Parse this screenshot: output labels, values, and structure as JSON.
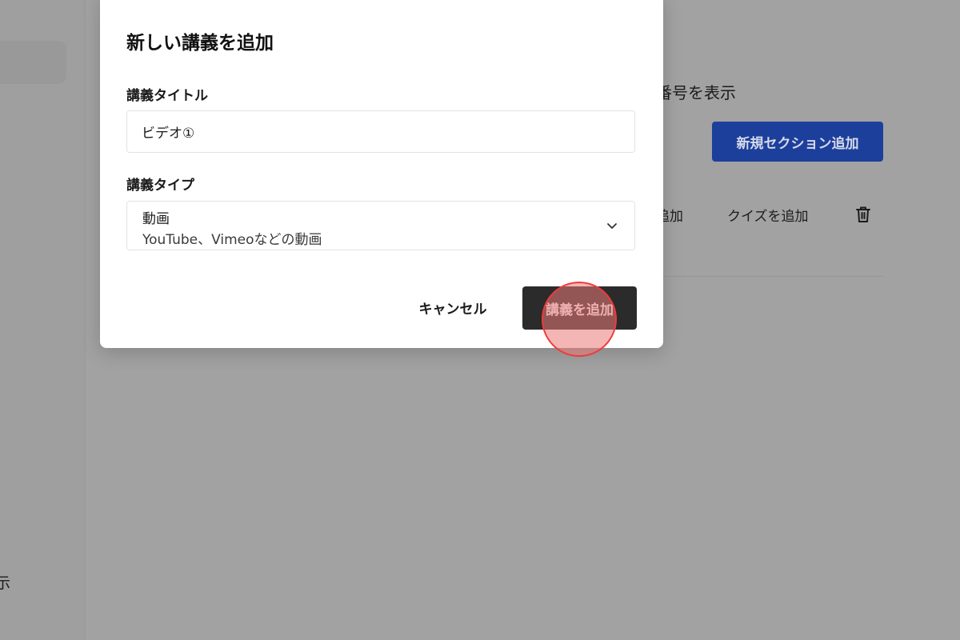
{
  "background": {
    "sidebar_partial_text": "示",
    "main_partial_text": "番号を表示",
    "new_section_button": "新規セクション追加",
    "add_lecture_partial": "追加",
    "add_quiz_link": "クイズを追加",
    "trash_icon": "trash-icon"
  },
  "modal": {
    "title": "新しい講義を追加",
    "title_field": {
      "label": "講義タイトル",
      "value": "ビデオ①"
    },
    "type_field": {
      "label": "講義タイプ",
      "selected": "動画",
      "selected_description": "YouTube、Vimeoなどの動画"
    },
    "cancel_label": "キャンセル",
    "submit_label": "講義を追加"
  },
  "colors": {
    "overlay": "#a2a2a2",
    "primary_button": "#1d3f9c",
    "submit_button": "#2b2b2b",
    "click_indicator": "#ef3b3b"
  }
}
